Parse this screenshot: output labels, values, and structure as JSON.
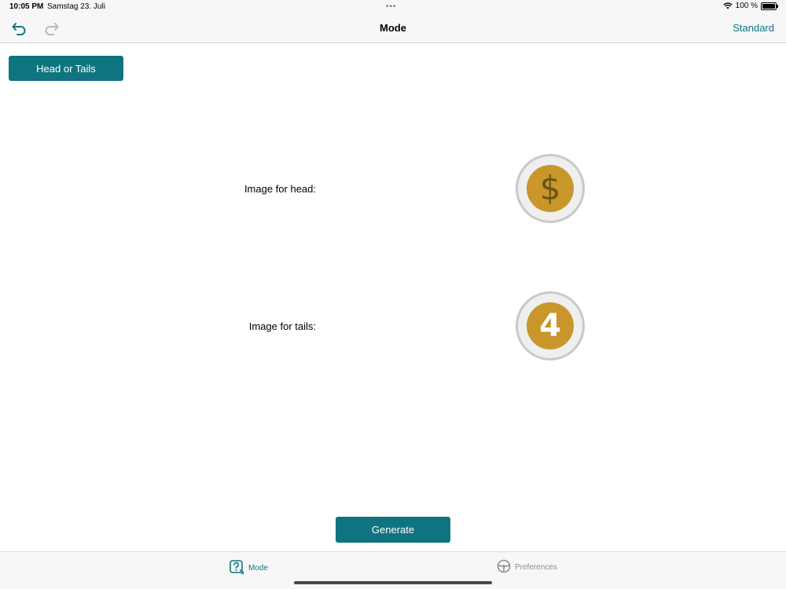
{
  "status_bar": {
    "time": "10:05 PM",
    "date": "Samstag 23. Juli",
    "dots": "•••",
    "battery_text": "100 %"
  },
  "nav": {
    "title": "Mode",
    "standard_label": "Standard",
    "undo_icon": "undo-arrow-icon",
    "redo_icon": "redo-arrow-icon"
  },
  "mode_button": {
    "label": "Head or Tails"
  },
  "head": {
    "label": "Image for head:",
    "glyph": "$"
  },
  "tails": {
    "label": "Image for tails:",
    "glyph": "4"
  },
  "generate_button": {
    "label": "Generate"
  },
  "tabbar": {
    "mode_label": "Mode",
    "preferences_label": "Preferences"
  },
  "colors": {
    "accent": "#0f7480",
    "coin_gold": "#c8962a",
    "coin_ring": "#c9c9c9",
    "inactive_tab": "#8e8e8e"
  }
}
